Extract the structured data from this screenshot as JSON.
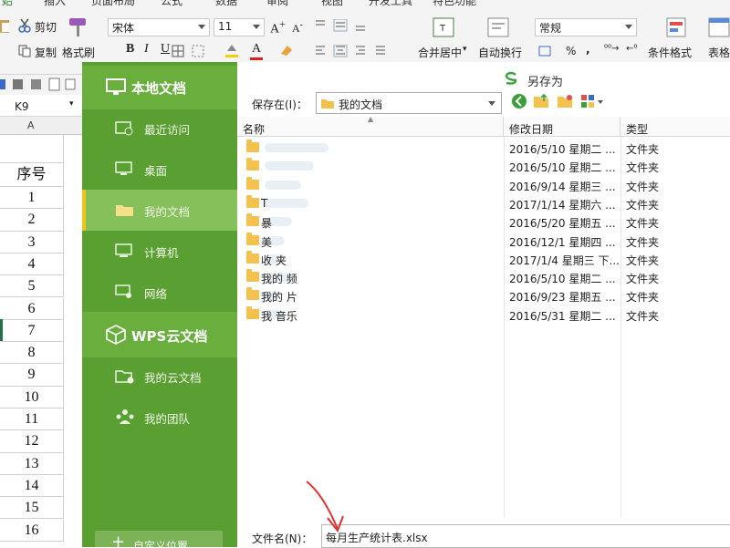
{
  "ribbon": {
    "tabs": [
      "始",
      "插入",
      "页面布局",
      "公式",
      "数据",
      "审阅",
      "视图",
      "开发工具",
      "特色功能"
    ],
    "cut": "剪切",
    "copy": "复制",
    "format_painter": "格式刷",
    "font_name": "宋体",
    "font_size": "11",
    "bold": "B",
    "italic": "I",
    "underline": "U",
    "merge_center": "合并居中",
    "wrap_text": "自动换行",
    "number_format": "常规",
    "percent": "%",
    "cond_format": "条件格式",
    "table_style": "表格",
    "font_color": "A"
  },
  "namebox": {
    "value": "K9"
  },
  "sheet": {
    "col_header": "A",
    "header_cell": "序号",
    "rows": [
      "1",
      "2",
      "3",
      "4",
      "5",
      "6",
      "7",
      "8",
      "9",
      "10",
      "11",
      "12",
      "13",
      "14",
      "15",
      "16"
    ]
  },
  "sidebar": {
    "local_title": "本地文档",
    "local_items": [
      {
        "label": "最近访问",
        "icon": "recent-icon"
      },
      {
        "label": "桌面",
        "icon": "desktop-icon"
      },
      {
        "label": "我的文档",
        "icon": "folder-icon"
      },
      {
        "label": "计算机",
        "icon": "computer-icon"
      },
      {
        "label": "网络",
        "icon": "network-icon"
      }
    ],
    "cloud_title": "WPS云文档",
    "cloud_items": [
      {
        "label": "我的云文档",
        "icon": "cloud-folder-icon"
      },
      {
        "label": "我的团队",
        "icon": "team-icon"
      }
    ],
    "custom_location": "自定义位置"
  },
  "dialog": {
    "title": "另存为",
    "save_in_label": "保存在(I)：",
    "save_in_value": "我的文档",
    "columns": {
      "name": "名称",
      "date": "修改日期",
      "type": "类型"
    },
    "files": [
      {
        "name": "",
        "date": "2016/5/10 星期二 ...",
        "type": "文件夹"
      },
      {
        "name": "",
        "date": "2016/5/10 星期二 ...",
        "type": "文件夹"
      },
      {
        "name": "",
        "date": "2016/9/14 星期三 ...",
        "type": "文件夹"
      },
      {
        "name": "T",
        "date": "2017/1/14 星期六 ...",
        "type": "文件夹"
      },
      {
        "name": "暴",
        "date": "2016/5/20 星期五 ...",
        "type": "文件夹"
      },
      {
        "name": "美",
        "date": "2016/12/1 星期四 ...",
        "type": "文件夹"
      },
      {
        "name": "收 夹",
        "date": "2017/1/4 星期三 下...",
        "type": "文件夹"
      },
      {
        "name": "我的 频",
        "date": "2016/5/10 星期二 ...",
        "type": "文件夹"
      },
      {
        "name": "我的 片",
        "date": "2016/9/23 星期五 ...",
        "type": "文件夹"
      },
      {
        "name": "我 音乐",
        "date": "2016/5/31 星期二 ...",
        "type": "文件夹"
      }
    ],
    "filename_label": "文件名(N)：",
    "filename_value": "每月生产统计表.xlsx"
  },
  "colors": {
    "sidebar_green": "#5a9f32",
    "selected_green": "#86c05b",
    "selection_bar": "#f0c419",
    "annotation_red": "#e03030"
  }
}
